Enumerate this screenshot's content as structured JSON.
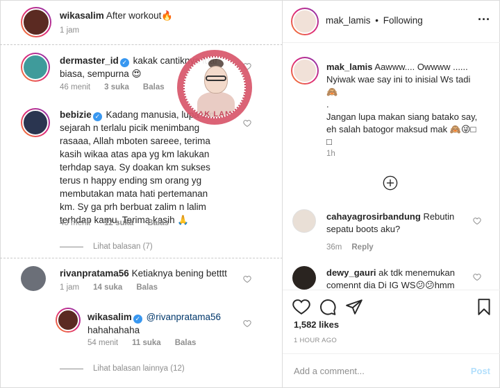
{
  "left": {
    "post_author": {
      "username": "wikasalim",
      "caption": "After workout🔥",
      "time": "1 jam"
    },
    "comments": [
      {
        "username": "dermaster_id",
        "text_line1": "kakak cantiknya luar",
        "text_line2": "biasa, sempurna 😍",
        "time": "46 menit",
        "likes": "3 suka",
        "reply": "Balas"
      },
      {
        "username": "bebizie",
        "lines": [
          "Kadang manusia, lupa sm",
          "sejarah n terlalu picik menimbang",
          "rasaaa, Allah mboten sareee, terima",
          "kasih wikaa atas apa yg km lakukan",
          "terhdap saya. Sy doakan km sukses",
          "terus n happy ending sm orang yg",
          "membutakan mata hati pertemanan",
          "km. Sy ga prh berbuat zalim n lalim",
          "terhdap kamu. Terima kasih 🙏"
        ],
        "time": "43 menit",
        "likes": "12 suka",
        "reply": "Balas",
        "view_replies": "Lihat balasan (7)"
      },
      {
        "username": "rivanpratama56",
        "text": "Ketiaknya bening betttt",
        "time": "1 jam",
        "likes": "14 suka",
        "reply": "Balas"
      }
    ],
    "reply": {
      "username": "wikasalim",
      "mention": "@rivanpratama56",
      "text": "hahahahaha",
      "time": "54 menit",
      "likes": "11 suka",
      "reply": "Balas"
    },
    "view_more_replies": "Lihat balasan lainnya (12)",
    "watermark_text": "MAK LAMIS"
  },
  "right": {
    "header": {
      "username": "mak_lamis",
      "separator": "•",
      "following": "Following",
      "more": "···"
    },
    "caption": {
      "username": "mak_lamis",
      "line1": "Aawww.... Owwww ......",
      "line2": "Nyiwak wae say ini to inisial Ws tadi",
      "line3": "🙈",
      "line4": ".",
      "line5": "Jangan lupa makan siang batako say,",
      "line6": "eh salah batogor maksud mak 🙈😜□",
      "line7": "□",
      "time": "1h"
    },
    "comments": [
      {
        "username": "cahayagrosirbandung",
        "text_line1": "Rebutin",
        "text_line2": "sepatu boots aku?",
        "time": "36m",
        "reply": "Reply"
      },
      {
        "username": "dewy_gauri",
        "text_line1": "ak tdk menemukan",
        "text_line2": "comennt dia Di IG WS😕😕hmm"
      }
    ],
    "likes": "1,582 likes",
    "post_time": "1 HOUR AGO",
    "comment_placeholder": "Add a comment...",
    "post_button": "Post"
  },
  "colors": {
    "accent": "#3897f0",
    "muted": "#8e8e8e",
    "post_disabled": "#b2dffc"
  }
}
